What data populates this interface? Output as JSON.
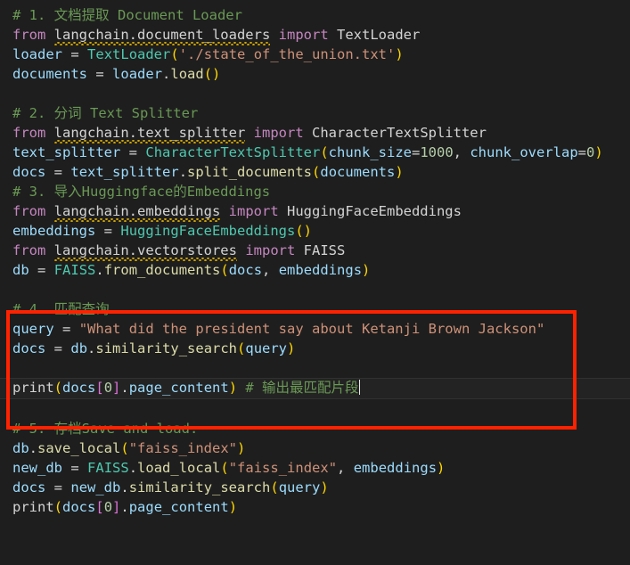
{
  "editor": {
    "background_color": "#1e1e1e",
    "language": "python",
    "current_line_index": 18,
    "caret_visible": true
  },
  "theme": {
    "comment": "#6a9955",
    "keyword": "#c586c0",
    "variable": "#9cdcfe",
    "class": "#4ec9b0",
    "function": "#dcdcaa",
    "string": "#ce9178",
    "number": "#b5cea8",
    "paren": "#ffd700",
    "bracket": "#da70d6",
    "plain": "#d4d4d4",
    "warning_squiggle": "#cda300",
    "current_line_bg": "#232323",
    "annotation_red": "#ff2200"
  },
  "annotation": {
    "type": "red-rectangle",
    "label": "highlighted-section-4"
  },
  "lines": [
    {
      "n": 1,
      "text": "# 1. 文档提取 Document Loader"
    },
    {
      "n": 2,
      "text": "from langchain.document_loaders import TextLoader"
    },
    {
      "n": 3,
      "text": "loader = TextLoader('./state_of_the_union.txt')"
    },
    {
      "n": 4,
      "text": "documents = loader.load()"
    },
    {
      "n": 5,
      "text": ""
    },
    {
      "n": 6,
      "text": "# 2. 分词 Text Splitter"
    },
    {
      "n": 7,
      "text": "from langchain.text_splitter import CharacterTextSplitter"
    },
    {
      "n": 8,
      "text": "text_splitter = CharacterTextSplitter(chunk_size=1000, chunk_overlap=0)"
    },
    {
      "n": 9,
      "text": "docs = text_splitter.split_documents(documents)"
    },
    {
      "n": 10,
      "text": "# 3. 导入Huggingface的Embeddings"
    },
    {
      "n": 11,
      "text": "from langchain.embeddings import HuggingFaceEmbeddings"
    },
    {
      "n": 12,
      "text": "embeddings = HuggingFaceEmbeddings()"
    },
    {
      "n": 13,
      "text": "from langchain.vectorstores import FAISS"
    },
    {
      "n": 14,
      "text": "db = FAISS.from_documents(docs, embeddings)"
    },
    {
      "n": 15,
      "text": ""
    },
    {
      "n": 16,
      "text": "# 4. 匹配查询"
    },
    {
      "n": 17,
      "text": "query = \"What did the president say about Ketanji Brown Jackson\""
    },
    {
      "n": 18,
      "text": "docs = db.similarity_search(query)"
    },
    {
      "n": 19,
      "text": ""
    },
    {
      "n": 20,
      "text": "print(docs[0].page_content) # 输出最匹配片段"
    },
    {
      "n": 21,
      "text": ""
    },
    {
      "n": 22,
      "text": "# 5. 存档Save and load:"
    },
    {
      "n": 23,
      "text": "db.save_local(\"faiss_index\")"
    },
    {
      "n": 24,
      "text": "new_db = FAISS.load_local(\"faiss_index\", embeddings)"
    },
    {
      "n": 25,
      "text": "docs = new_db.similarity_search(query)"
    },
    {
      "n": 26,
      "text": "print(docs[0].page_content)"
    }
  ],
  "tokens": {
    "c1": "# 1. 文档提取 Document Loader",
    "kw_from": "from",
    "kw_import": "import",
    "mod1": "langchain.document_loaders",
    "cls_TextLoader": "TextLoader",
    "var_loader": "loader",
    "eq": "=",
    "str_path": "'./state_of_the_union.txt'",
    "var_documents": "documents",
    "var_loader2": "loader",
    "dot": ".",
    "fn_load": "load",
    "c2": "# 2. 分词 Text Splitter",
    "mod2": "langchain.text_splitter",
    "cls_CharacterTextSplitter": "CharacterTextSplitter",
    "var_text_splitter": "text_splitter",
    "kwarg_chunk_size": "chunk_size",
    "num_1000": "1000",
    "comma": ", ",
    "kwarg_chunk_overlap": "chunk_overlap",
    "num_0": "0",
    "var_docs": "docs",
    "fn_split_documents": "split_documents",
    "c3": "# 3. 导入Huggingface的Embeddings",
    "mod3": "langchain.embeddings",
    "cls_HuggingFaceEmbeddings": "HuggingFaceEmbeddings",
    "var_embeddings": "embeddings",
    "mod4": "langchain.vectorstores",
    "cls_FAISS": "FAISS",
    "var_db": "db",
    "fn_from_documents": "from_documents",
    "c4": "# 4. 匹配查询",
    "var_query": "query",
    "str_question": "\"What did the president say about Ketanji Brown Jackson\"",
    "fn_similarity_search": "similarity_search",
    "fn_print": "print",
    "idx_0": "0",
    "attr_page_content": "page_content",
    "c5_inline": "# 输出最匹配片段",
    "c6": "# 5. 存档Save and load:",
    "fn_save_local": "save_local",
    "str_faiss_index": "\"faiss_index\"",
    "var_new_db": "new_db",
    "fn_load_local": "load_local",
    "lparen": "(",
    "rparen": ")",
    "lbrk": "[",
    "rbrk": "]"
  }
}
